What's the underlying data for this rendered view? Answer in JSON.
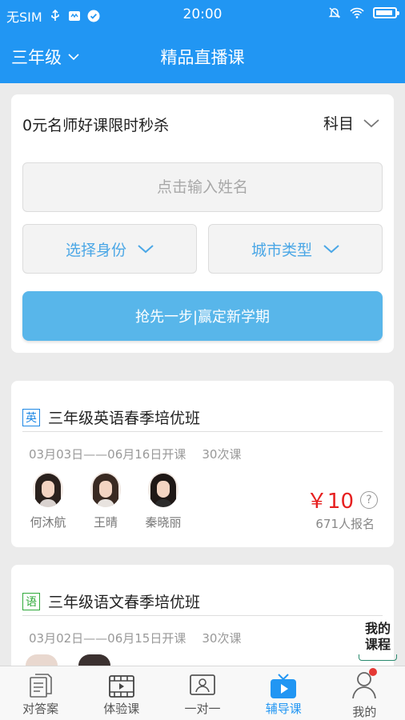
{
  "status_bar": {
    "carrier": "无SIM",
    "time": "20:00"
  },
  "header": {
    "grade": "三年级",
    "title": "精品直播课"
  },
  "promo": {
    "title": "0元名师好课限时秒杀",
    "subject_label": "科目",
    "name_placeholder": "点击输入姓名",
    "role_label": "选择身份",
    "city_label": "城市类型",
    "cta_label": "抢先一步|赢定新学期"
  },
  "courses": [
    {
      "badge": "英",
      "name": "三年级英语春季培优班",
      "dates": "03月03日——06月16日开课",
      "sessions": "30次课",
      "teachers": [
        "何沐航",
        "王晴",
        "秦晓丽"
      ],
      "price": "￥10",
      "enrolled": "671人报名"
    },
    {
      "badge": "语",
      "name": "三年级语文春季培优班",
      "dates": "03月02日——06月15日开课",
      "sessions": "30次课"
    }
  ],
  "float": {
    "line1": "我的",
    "line2": "课程"
  },
  "tabs": [
    {
      "label": "对答案",
      "icon": "answers-icon"
    },
    {
      "label": "体验课",
      "icon": "video-icon"
    },
    {
      "label": "一对一",
      "icon": "one-on-one-icon"
    },
    {
      "label": "辅导课",
      "icon": "tv-play-icon"
    },
    {
      "label": "我的",
      "icon": "user-icon"
    }
  ],
  "colors": {
    "primary": "#2196f3",
    "cta": "#58b6ea",
    "price": "#e62020",
    "english": "#1e88e5",
    "chinese": "#2faa3a"
  }
}
